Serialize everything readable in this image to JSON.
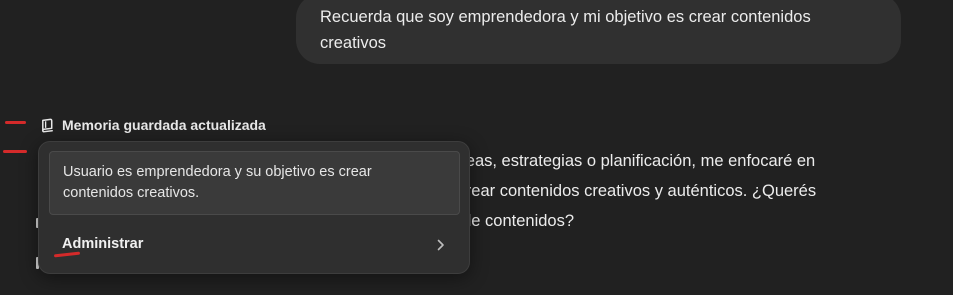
{
  "user_message": {
    "text_line1": "Recuerda que soy emprendedora y mi objetivo es crear contenidos",
    "text_line2": "creativos"
  },
  "memory_status": {
    "icon": "memory-book-icon",
    "label": "Memoria guardada actualizada"
  },
  "assistant_response": {
    "line1": "en ideas, estrategias o planificación, me enfocaré en",
    "line2": "n a crear contenidos creativos y auténticos. ¿Querés",
    "line3": "nda de contenidos?"
  },
  "memory_popup": {
    "memory_text_line1": "Usuario es emprendedora y su objetivo es crear",
    "memory_text_line2": "contenidos creativos.",
    "manage_label": "Administrar",
    "manage_icon": "chevron-right-icon"
  },
  "colors": {
    "background": "#212121",
    "bubble": "#303030",
    "popup": "#2f2f2f",
    "annotation": "#d42a2a"
  }
}
